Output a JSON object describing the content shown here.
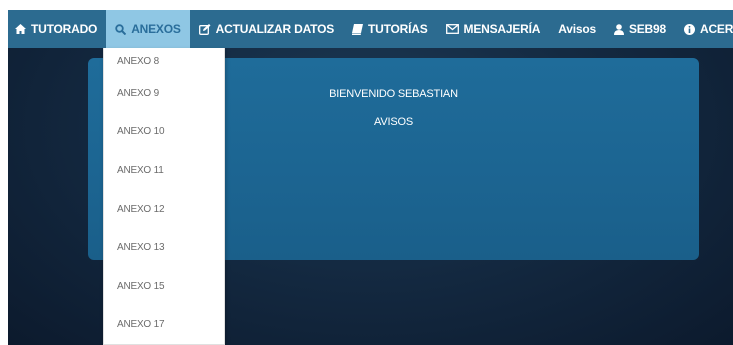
{
  "navbar": {
    "items": [
      {
        "label": "TUTORADO",
        "icon": "home-icon"
      },
      {
        "label": "ANEXOS",
        "icon": "search-icon",
        "active": true
      },
      {
        "label": "ACTUALIZAR DATOS",
        "icon": "edit-icon"
      },
      {
        "label": "TUTORÍAS",
        "icon": "book-icon"
      },
      {
        "label": "MENSAJERÍA",
        "icon": "envelope-icon"
      },
      {
        "label": "Avisos",
        "icon": ""
      },
      {
        "label": "SEB98",
        "icon": "user-icon"
      },
      {
        "label": "ACERCA DE",
        "icon": "info-icon"
      }
    ]
  },
  "dropdown": {
    "items": [
      "ANEXO 8",
      "ANEXO 9",
      "ANEXO 10",
      "ANEXO 11",
      "ANEXO 12",
      "ANEXO 13",
      "ANEXO 15",
      "ANEXO 17"
    ]
  },
  "panel": {
    "title": "BIENVENIDO SEBASTIAN",
    "subtitle": "AVISOS"
  },
  "colors": {
    "navbar": "#2c6b90",
    "active_tab": "#8fc7e4",
    "panel": "#1f6c9a",
    "background": "#142a42"
  }
}
